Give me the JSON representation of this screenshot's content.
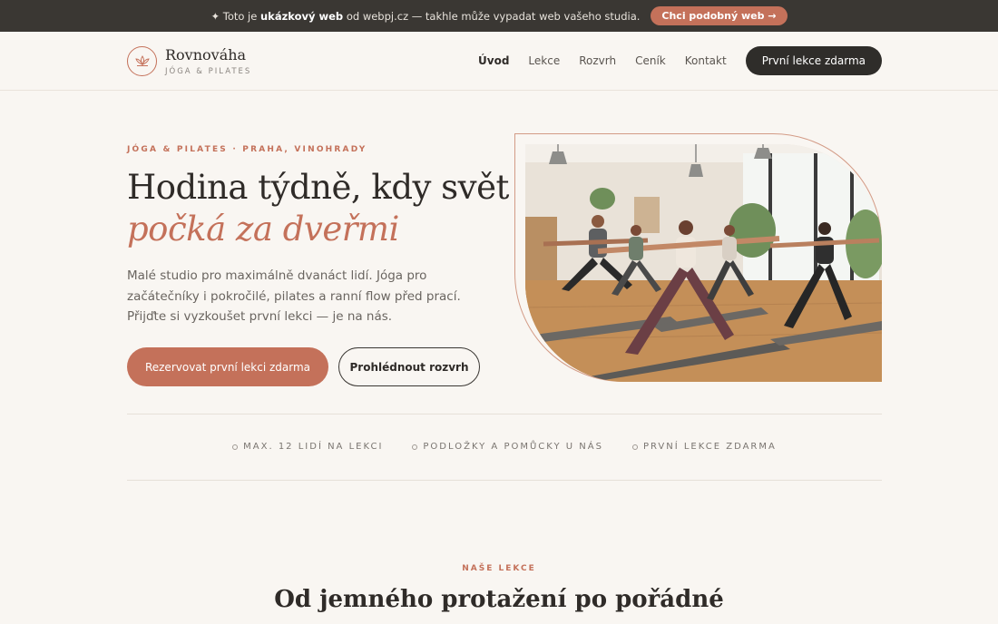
{
  "promo": {
    "prefix": "✦ Toto je",
    "bold": "ukázkový web",
    "suffix": "od webpj.cz — takhle může vypadat web vašeho studia.",
    "button": "Chci podobný web →"
  },
  "brand": {
    "name": "Rovnováha",
    "tagline": "JÓGA & PILATES",
    "logo_icon": "lotus-icon"
  },
  "nav": {
    "items": [
      "Úvod",
      "Lekce",
      "Rozvrh",
      "Ceník",
      "Kontakt"
    ],
    "cta": "První lekce zdarma"
  },
  "hero": {
    "eyebrow": "JÓGA & PILATES · PRAHA, VINOHRADY",
    "title_line1": "Hodina týdně, kdy svět",
    "title_line2": "počká za dveřmi",
    "text": "Malé studio pro maximálně dvanáct lidí. Jóga pro začátečníky i pokročilé, pilates a ranní flow před prací. Přijďte si vyzkoušet první lekci — je na nás.",
    "primary_button": "Rezervovat první lekci zdarma",
    "secondary_button": "Prohlédnout rozvrh"
  },
  "features": [
    "MAX. 12 LIDÍ NA LEKCI",
    "PODLOŽKY A POMŮCKY U NÁS",
    "PRVNÍ LEKCE ZDARMA"
  ],
  "section": {
    "eyebrow": "NAŠE LEKCE",
    "title": "Od jemného protažení po pořádné"
  },
  "colors": {
    "accent": "#c4715a",
    "dark": "#2f2d2a",
    "background": "#f9f6f2"
  }
}
